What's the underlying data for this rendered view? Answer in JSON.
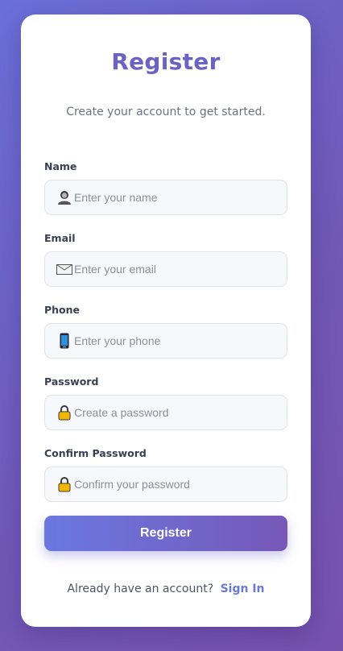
{
  "title": "Register",
  "subtitle": "Create your account to get started.",
  "fields": {
    "name": {
      "label": "Name",
      "placeholder": "Enter your name",
      "icon": "user-icon"
    },
    "email": {
      "label": "Email",
      "placeholder": "Enter your email",
      "icon": "envelope-icon"
    },
    "phone": {
      "label": "Phone",
      "placeholder": "Enter your phone",
      "icon": "phone-icon"
    },
    "password": {
      "label": "Password",
      "placeholder": "Create a password",
      "icon": "lock-icon"
    },
    "confirm_password": {
      "label": "Confirm Password",
      "placeholder": "Confirm your password",
      "icon": "lock-icon"
    }
  },
  "register_button": "Register",
  "footer": {
    "prompt": "Already have an account?",
    "link": "Sign In"
  },
  "colors": {
    "accent": "#6b63c4",
    "link": "#6a78d8",
    "background_start": "#6a6fd8",
    "background_end": "#7652ad"
  }
}
